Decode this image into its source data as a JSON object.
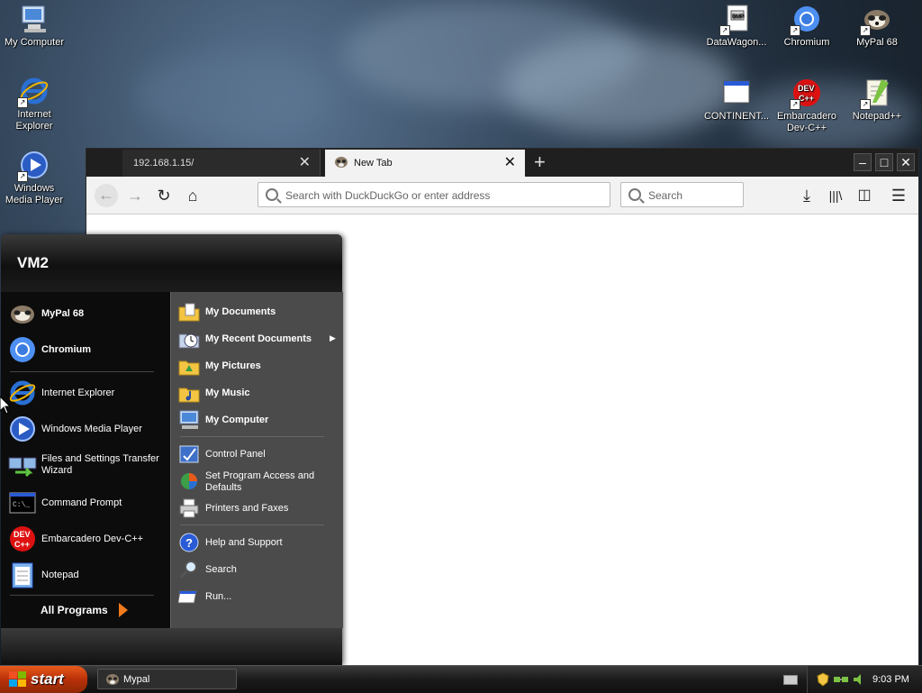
{
  "desktop": {
    "icons": [
      {
        "label": "My Computer",
        "icon": "my-computer-icon"
      },
      {
        "label": "Internet Explorer",
        "icon": "internet-explorer-icon"
      },
      {
        "label": "Windows Media Player",
        "icon": "windows-media-player-icon"
      },
      {
        "label": "DataWagon...",
        "icon": "datawagon-icon"
      },
      {
        "label": "Chromium",
        "icon": "chromium-icon"
      },
      {
        "label": "MyPal 68",
        "icon": "mypal-icon"
      },
      {
        "label": "CONTINENT...",
        "icon": "continent-window-icon"
      },
      {
        "label": "Embarcadero Dev-C++",
        "icon": "devcpp-icon"
      },
      {
        "label": "Notepad++",
        "icon": "notepadpp-icon"
      }
    ]
  },
  "browser": {
    "tabs": [
      {
        "title": "192.168.1.15/",
        "active": false
      },
      {
        "title": "New Tab",
        "active": true
      }
    ],
    "new_tab_label": "+",
    "window_buttons": {
      "minimize": "–",
      "maximize": "□",
      "close": "✕"
    },
    "url_placeholder": "Search with DuckDuckGo or enter address",
    "search_placeholder": "Search"
  },
  "start_menu": {
    "user": "VM2",
    "pinned": [
      {
        "label": "MyPal 68",
        "icon": "mypal-icon"
      },
      {
        "label": "Chromium",
        "icon": "chromium-icon"
      }
    ],
    "recent": [
      {
        "label": "Internet Explorer",
        "icon": "internet-explorer-icon"
      },
      {
        "label": "Windows Media Player",
        "icon": "windows-media-player-icon"
      },
      {
        "label": "Files and Settings Transfer Wizard",
        "icon": "transfer-wizard-icon"
      },
      {
        "label": "Command Prompt",
        "icon": "command-prompt-icon"
      },
      {
        "label": "Embarcadero Dev-C++",
        "icon": "devcpp-icon"
      },
      {
        "label": "Notepad",
        "icon": "notepad-icon"
      }
    ],
    "all_programs": "All Programs",
    "places": [
      {
        "label": "My Documents",
        "icon": "my-documents-icon"
      },
      {
        "label": "My Recent Documents",
        "icon": "recent-documents-icon"
      },
      {
        "label": "My Pictures",
        "icon": "my-pictures-icon"
      },
      {
        "label": "My Music",
        "icon": "my-music-icon"
      },
      {
        "label": "My Computer",
        "icon": "my-computer-icon"
      }
    ],
    "system": [
      {
        "label": "Control Panel",
        "icon": "control-panel-icon"
      },
      {
        "label": "Set Program Access and Defaults",
        "icon": "program-defaults-icon"
      },
      {
        "label": "Printers and Faxes",
        "icon": "printer-icon"
      }
    ],
    "help": [
      {
        "label": "Help and Support",
        "icon": "help-icon"
      },
      {
        "label": "Search",
        "icon": "search-icon"
      },
      {
        "label": "Run...",
        "icon": "run-icon"
      }
    ]
  },
  "taskbar": {
    "start_label": "start",
    "task": "Mypal",
    "clock": "9:03 PM"
  }
}
